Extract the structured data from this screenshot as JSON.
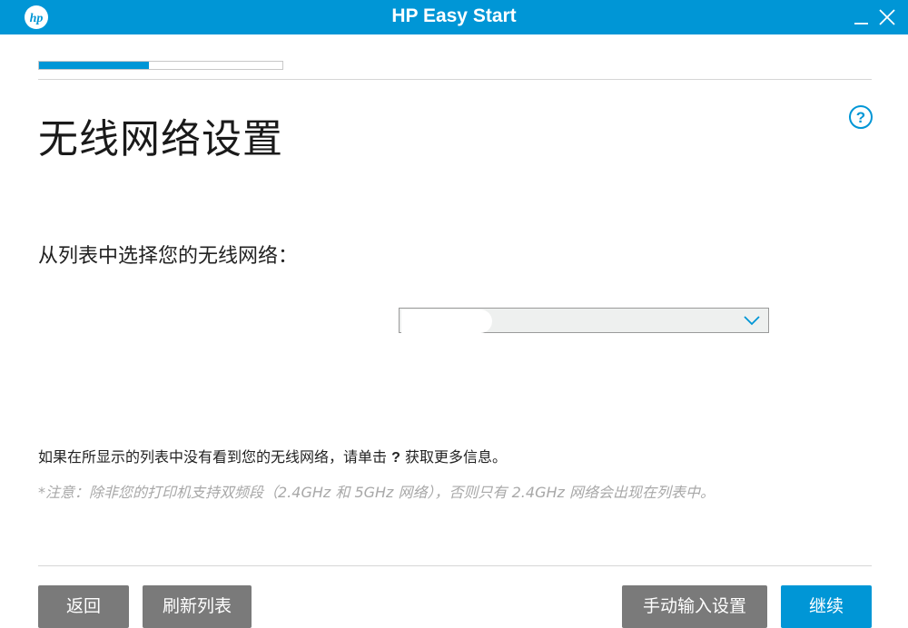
{
  "window": {
    "title": "HP Easy Start",
    "logo": "hp-logo",
    "controls": [
      "minimize-icon",
      "close-icon"
    ]
  },
  "progress": {
    "fraction": 0.45
  },
  "page": {
    "title": "无线网络设置",
    "help_icon": "question-circle-icon",
    "prompt": "从列表中选择您的无线网络："
  },
  "network_select": {
    "value": "",
    "icon": "chevron-down-icon"
  },
  "info": {
    "line_before": "如果在所显示的列表中没有看到您的无线网络，请单击",
    "help_mark": "?",
    "line_after": "获取更多信息。",
    "note": "*注意：除非您的打印机支持双频段（2.4GHz 和 5GHz 网络），否则只有 2.4GHz 网络会出现在列表中。"
  },
  "buttons": {
    "back": "返回",
    "refresh": "刷新列表",
    "manual": "手动输入设置",
    "continue": "继续"
  },
  "colors": {
    "accent": "#0096d6",
    "button_grey": "#7a7a7a",
    "note_text": "#a8a8a8"
  }
}
